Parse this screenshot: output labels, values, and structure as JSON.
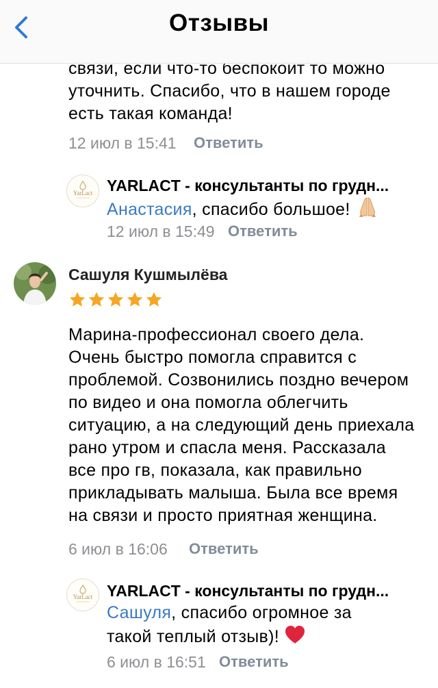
{
  "header": {
    "title": "Отзывы"
  },
  "review1": {
    "lines": [
      "связи, если что-то беспокоит то можно",
      "уточнить. Спасибо, что в нашем городе",
      "есть такая команда!"
    ],
    "date": "12 июл в 15:41",
    "reply_label": "Ответить",
    "reply": {
      "org": "YARLACT - консультанты по грудн...",
      "logo_text": "YarLact",
      "mention": "Анастасия",
      "line1_rest": ", спасибо большое!",
      "emoji": "folded-hands-icon",
      "date": "12 июл в 15:49",
      "reply_label": "Ответить"
    }
  },
  "review2": {
    "author": "Сашуля Кушмылёва",
    "rating": 5,
    "lines": [
      "Марина-профессионал своего дела.",
      "Очень быстро помогла справится с",
      "проблемой. Созвонились поздно вечером",
      "по видео и она помогла облегчить",
      "ситуацию, а на следующий день приехала",
      "рано утром и спасла меня. Рассказала",
      "все про гв, показала, как правильно",
      "прикладывать малыша. Была все время",
      "на связи и просто приятная женщина."
    ],
    "date": "6 июл в 16:06",
    "reply_label": "Ответить",
    "reply": {
      "org": "YARLACT - консультанты по грудн...",
      "logo_text": "YarLact",
      "mention": "Сашуля",
      "line1_rest": ", спасибо огромное за",
      "line2": "такой теплый отзыв)!",
      "emoji": "red-heart-icon",
      "date": "6 июл в 16:51",
      "reply_label": "Ответить"
    }
  },
  "colors": {
    "accent": "#3a7ac2",
    "star": "#f5a623",
    "heart": "#e0243b",
    "meta": "#8e8e93"
  }
}
